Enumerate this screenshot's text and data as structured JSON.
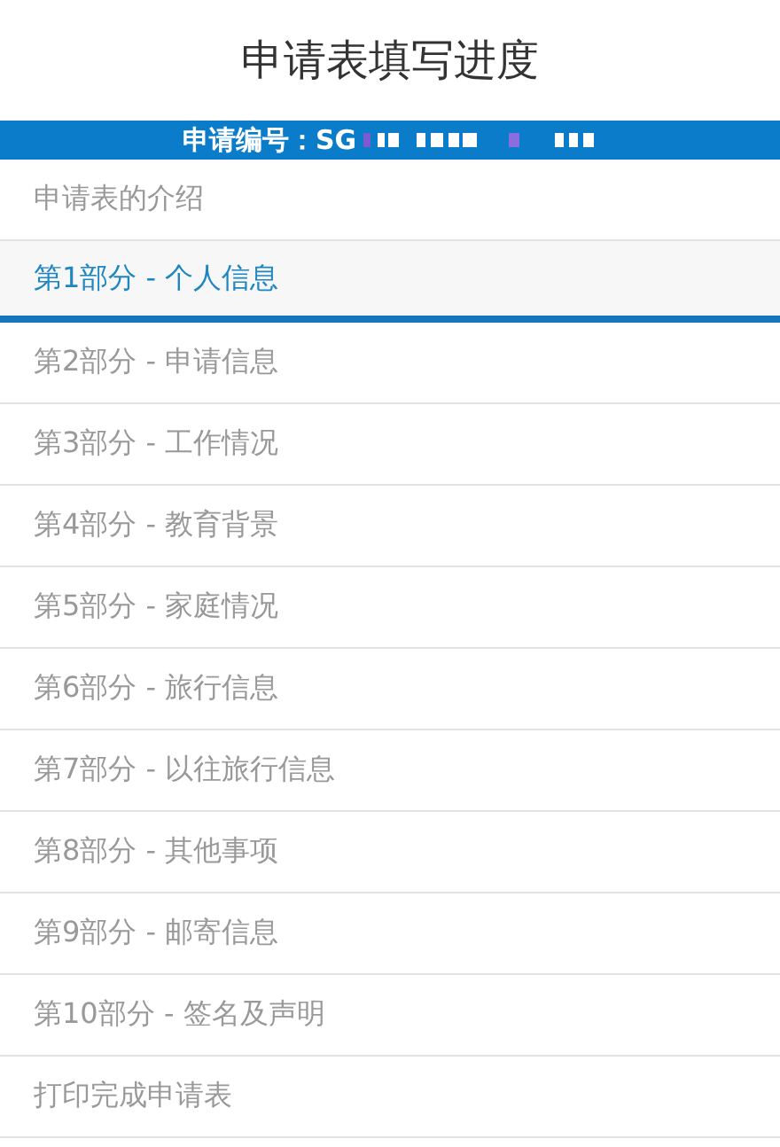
{
  "header": {
    "title": "申请表填写进度"
  },
  "application_bar": {
    "label": "申请编号：SG"
  },
  "sections": [
    {
      "label": "申请表的介绍",
      "selected": false
    },
    {
      "label": "第1部分 - 个人信息",
      "selected": true
    },
    {
      "label": "第2部分 - 申请信息",
      "selected": false
    },
    {
      "label": "第3部分 - 工作情况",
      "selected": false
    },
    {
      "label": "第4部分 - 教育背景",
      "selected": false
    },
    {
      "label": "第5部分 - 家庭情况",
      "selected": false
    },
    {
      "label": "第6部分 - 旅行信息",
      "selected": false
    },
    {
      "label": "第7部分 - 以往旅行信息",
      "selected": false
    },
    {
      "label": "第8部分 - 其他事项",
      "selected": false
    },
    {
      "label": "第9部分 - 邮寄信息",
      "selected": false
    },
    {
      "label": "第10部分 - 签名及声明",
      "selected": false
    },
    {
      "label": "打印完成申请表",
      "selected": false
    }
  ]
}
